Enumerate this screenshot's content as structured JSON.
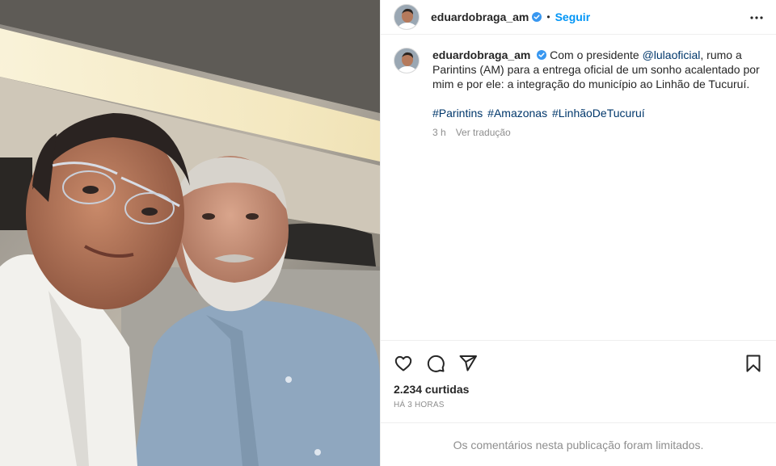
{
  "post": {
    "photo": {
      "icon": "selfie-photo",
      "description_alt": ""
    },
    "author": {
      "username": "eduardobraga_am",
      "verified": true
    },
    "header": {
      "separator": "•",
      "follow_label": "Seguir",
      "more_icon": "more-horizontal-icon"
    },
    "caption": {
      "text_before_mention": "Com o presidente ",
      "mention": "@lulaoficial",
      "text_after_mention": ", rumo a Parintins (AM) para a entrega oficial de um sonho acalentado por mim e por ele: a integração do município ao Linhão de Tucuruí.",
      "hashtags": [
        "#Parintins",
        "#Amazonas",
        "#LinhãoDeTucuruí"
      ],
      "age": "3 h",
      "translate_label": "Ver tradução"
    },
    "actions": {
      "like_icon": "heart-icon",
      "comment_icon": "comment-icon",
      "share_icon": "share-icon",
      "save_icon": "bookmark-icon"
    },
    "likes": "2.234 curtidas",
    "timestamp": "HÁ 3 HORAS",
    "comments_notice": "Os comentários nesta publicação foram limitados.",
    "colors": {
      "link": "#00376b",
      "follow": "#0095f6",
      "verified": "#3897f0",
      "muted": "#8e8e8e",
      "text": "#262626",
      "border": "#efefef"
    }
  }
}
